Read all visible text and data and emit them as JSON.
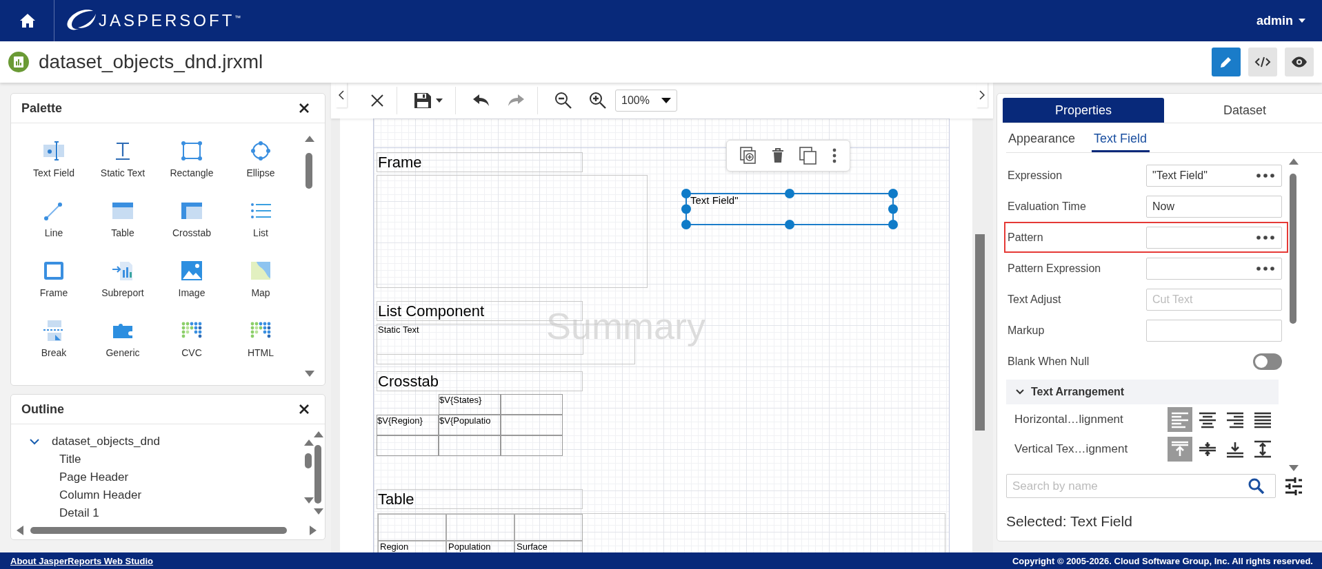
{
  "header": {
    "logo_text": "JASPERSOFT$^{™}$",
    "user": "admin"
  },
  "document": {
    "title": "dataset_objects_dnd.jrxml",
    "view_modes": [
      {
        "kind": "design",
        "selected": true
      },
      {
        "kind": "source",
        "selected": false
      },
      {
        "kind": "preview",
        "selected": false
      }
    ]
  },
  "palette": {
    "title": "Palette",
    "items": [
      {
        "label": "Text Field",
        "kind": "text-field"
      },
      {
        "label": "Static Text",
        "kind": "static-text"
      },
      {
        "label": "Rectangle",
        "kind": "rectangle"
      },
      {
        "label": "Ellipse",
        "kind": "ellipse"
      },
      {
        "label": "Line",
        "kind": "line"
      },
      {
        "label": "Table",
        "kind": "table"
      },
      {
        "label": "Crosstab",
        "kind": "crosstab"
      },
      {
        "label": "List",
        "kind": "list"
      },
      {
        "label": "Frame",
        "kind": "frame"
      },
      {
        "label": "Subreport",
        "kind": "subreport"
      },
      {
        "label": "Image",
        "kind": "image"
      },
      {
        "label": "Map",
        "kind": "map"
      },
      {
        "label": "Break",
        "kind": "break"
      },
      {
        "label": "Generic",
        "kind": "generic"
      },
      {
        "label": "CVC",
        "kind": "cvc"
      },
      {
        "label": "HTML",
        "kind": "html"
      }
    ]
  },
  "outline": {
    "title": "Outline",
    "tree": [
      {
        "label": "dataset_objects_dnd",
        "expanded": true,
        "children": [
          {
            "label": "Title"
          },
          {
            "label": "Page Header"
          },
          {
            "label": "Column Header"
          },
          {
            "label": "Detail 1"
          }
        ]
      }
    ]
  },
  "toolbar": {
    "undo": {
      "disabled": false
    },
    "redo": {
      "disabled": true
    },
    "zoom_level": "100%"
  },
  "canvas": {
    "band_label": "Summary",
    "frame": {
      "label": "Frame"
    },
    "list_component": {
      "label": "List Component",
      "static_text": "Static Text"
    },
    "selected_element": {
      "text": "Text Field\"",
      "selected": true
    },
    "crosstab": {
      "label": "Crosstab",
      "column_header": "$V{States}",
      "row_header": "$V{Region}",
      "measure": "$V{Populatio"
    },
    "table": {
      "label": "Table",
      "columns": [
        "Region",
        "Population",
        "Surface"
      ]
    }
  },
  "properties": {
    "tabs": [
      {
        "label": "Properties",
        "selected": true
      },
      {
        "label": "Dataset",
        "selected": false
      }
    ],
    "subtabs": [
      {
        "label": "Appearance",
        "selected": false
      },
      {
        "label": "Text Field",
        "selected": true
      }
    ],
    "fields": [
      {
        "label": "Expression",
        "value": "\"Text Field\"",
        "has_editor": true,
        "highlighted": false
      },
      {
        "label": "Evaluation Time",
        "value": "Now",
        "has_editor": false,
        "highlighted": false
      },
      {
        "label": "Pattern",
        "has_editor": true,
        "highlighted": true
      },
      {
        "label": "Pattern Expression",
        "has_editor": true,
        "highlighted": false
      },
      {
        "label": "Text Adjust",
        "placeholder": "Cut Text",
        "has_editor": false,
        "highlighted": false
      },
      {
        "label": "Markup",
        "has_editor": false,
        "highlighted": false
      }
    ],
    "blank_when_null": {
      "label": "Blank When Null",
      "on": false
    },
    "section": {
      "title": "Text Arrangement",
      "expanded": true,
      "rows": [
        {
          "label": "Horizontal…lignment",
          "options": [
            {
              "kind": "left",
              "selected": true
            },
            {
              "kind": "center",
              "selected": false
            },
            {
              "kind": "right",
              "selected": false
            },
            {
              "kind": "justify",
              "selected": false
            }
          ]
        },
        {
          "label": "Vertical Tex…ignment",
          "options": [
            {
              "kind": "top",
              "selected": true
            },
            {
              "kind": "middle",
              "selected": false
            },
            {
              "kind": "bottom",
              "selected": false
            },
            {
              "kind": "stretch",
              "selected": false
            }
          ]
        }
      ]
    },
    "search": {
      "placeholder": "Search by name"
    },
    "status": "Selected: Text Field"
  },
  "footer": {
    "link": "About JasperReports Web Studio",
    "copyright": "Copyright © 2005-2026. Cloud Software Group, Inc. All rights reserved."
  }
}
